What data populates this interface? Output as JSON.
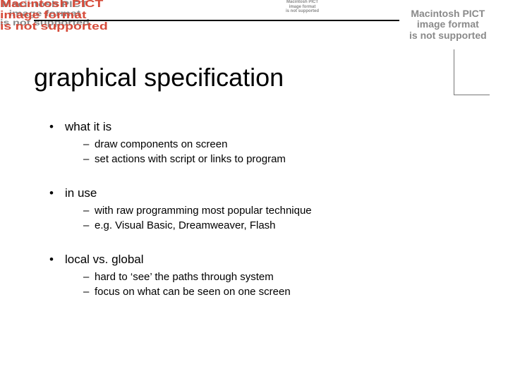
{
  "pict_error": {
    "l1": "Macintosh PICT",
    "l2": "image format",
    "l3": "is not supported"
  },
  "title": "graphical specification",
  "bullets": [
    {
      "label": "what it is",
      "subs": [
        "draw components on screen",
        "set actions with script or links to program"
      ]
    },
    {
      "label": "in use",
      "subs": [
        "with raw programming most popular technique",
        "e.g. Visual Basic,  Dreamweaver,  Flash"
      ]
    },
    {
      "label": "local vs. global",
      "subs": [
        "hard to ‘see’ the paths through system",
        "focus on what can be seen on one screen"
      ]
    }
  ]
}
